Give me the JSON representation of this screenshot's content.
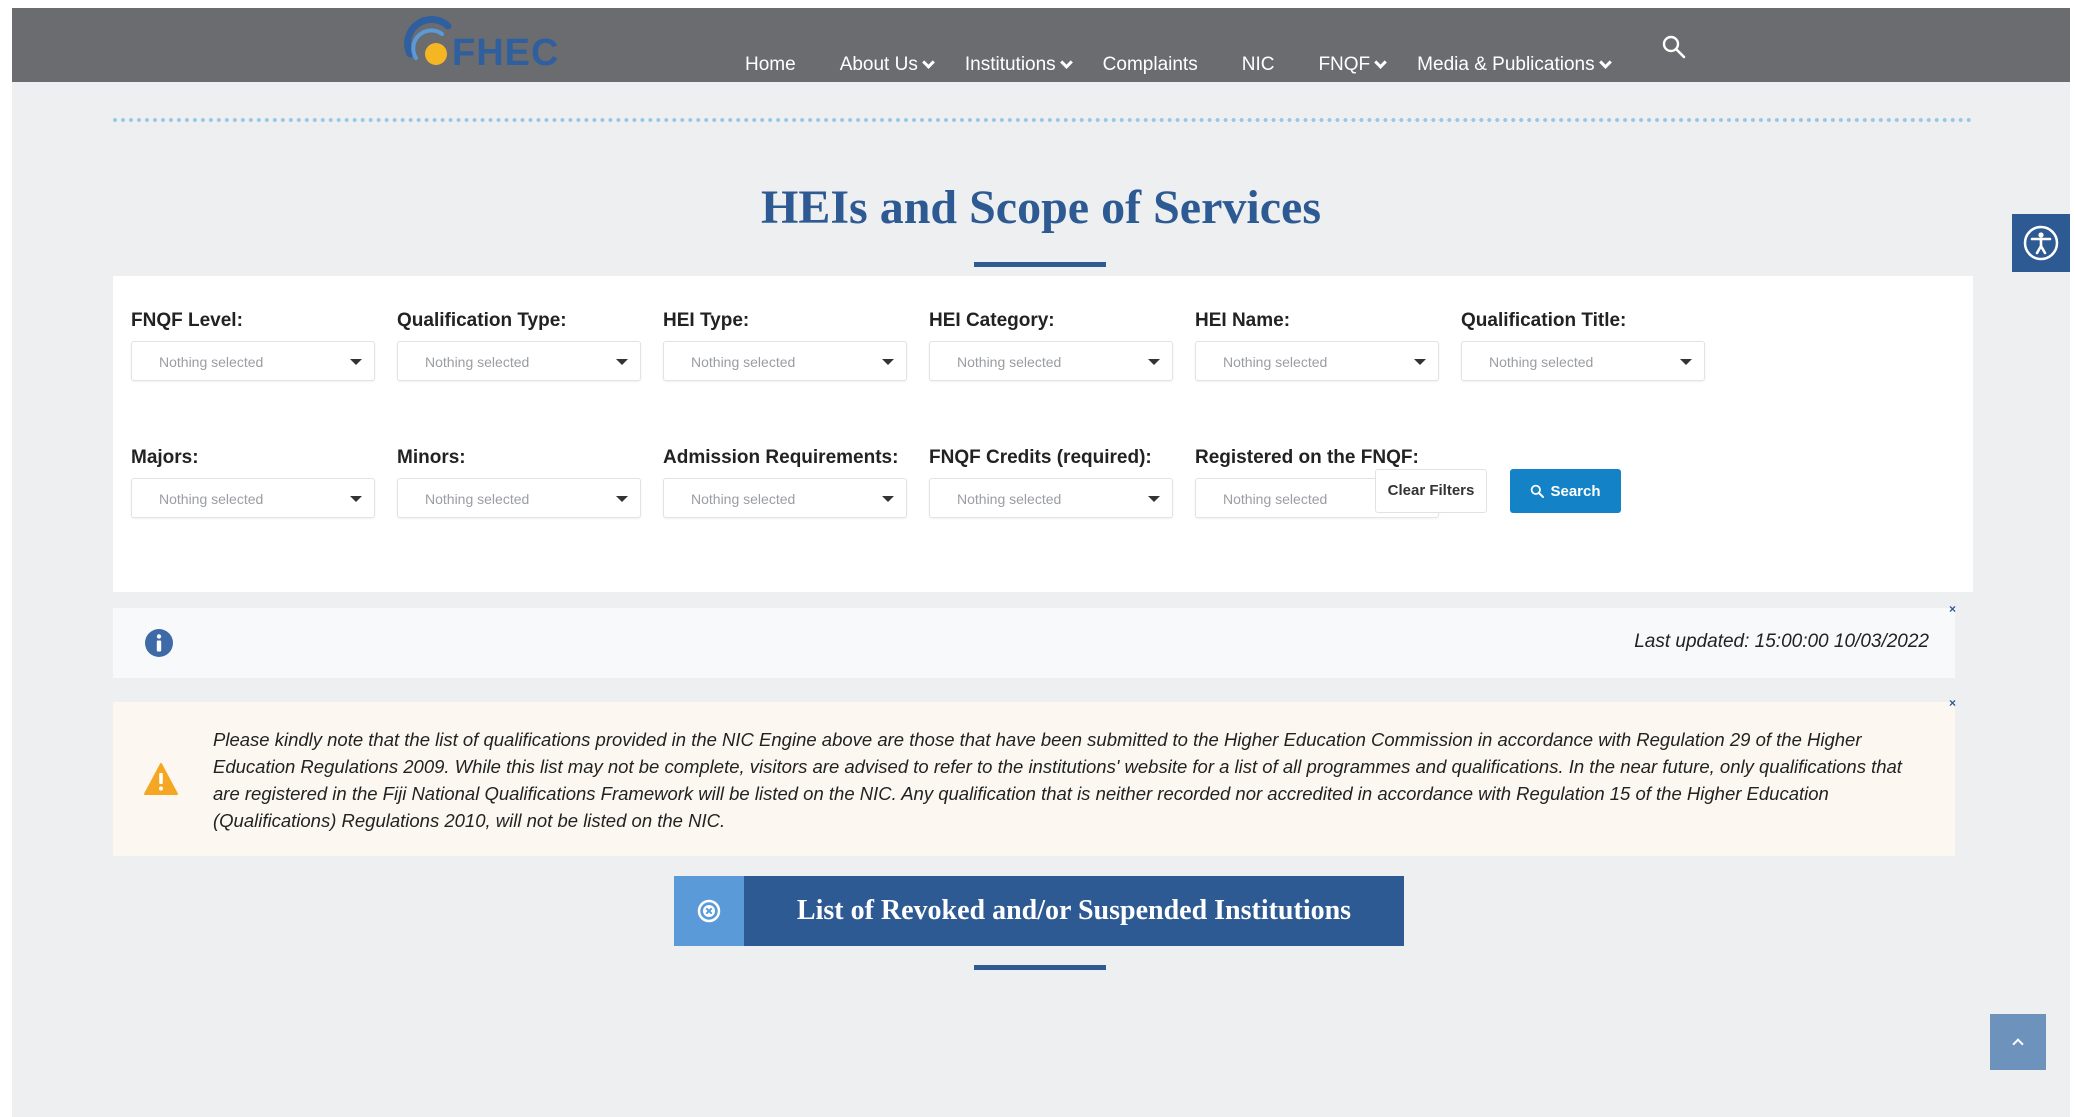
{
  "header": {
    "logo_text": "FHEC",
    "nav": [
      {
        "label": "Home",
        "dropdown": false
      },
      {
        "label": "About Us",
        "dropdown": true
      },
      {
        "label": "Institutions",
        "dropdown": true
      },
      {
        "label": "Complaints",
        "dropdown": false
      },
      {
        "label": "NIC",
        "dropdown": false
      },
      {
        "label": "FNQF",
        "dropdown": true
      },
      {
        "label": "Media & Publications",
        "dropdown": true
      }
    ],
    "search_icon": "search-icon"
  },
  "page_title": "HEIs and Scope of Services",
  "filters": {
    "fnqf_level": {
      "label": "FNQF Level:",
      "value": "Nothing selected"
    },
    "qualification_type": {
      "label": "Qualification Type:",
      "value": "Nothing selected"
    },
    "hei_type": {
      "label": "HEI Type:",
      "value": "Nothing selected"
    },
    "hei_category": {
      "label": "HEI Category:",
      "value": "Nothing selected"
    },
    "hei_name": {
      "label": "HEI Name:",
      "value": "Nothing selected"
    },
    "qualification_title": {
      "label": "Qualification Title:",
      "value": "Nothing selected"
    },
    "majors": {
      "label": "Majors:",
      "value": "Nothing selected"
    },
    "minors": {
      "label": "Minors:",
      "value": "Nothing selected"
    },
    "admission_requirements": {
      "label": "Admission Requirements:",
      "value": "Nothing selected"
    },
    "fnqf_credits": {
      "label": "FNQF Credits (required):",
      "value": "Nothing selected"
    },
    "registered_fnqf": {
      "label": "Registered on the FNQF:",
      "value": "Nothing selected"
    },
    "clear_label": "Clear Filters",
    "search_label": "Search"
  },
  "info": {
    "last_updated": "Last updated: 15:00:00 10/03/2022",
    "close": "×"
  },
  "notice": {
    "text": "Please kindly note that the list of qualifications provided in the NIC Engine above are those that have been submitted to the Higher Education Commission in accordance with Regulation 29 of the Higher Education Regulations 2009. While this list may not be complete, visitors are advised to refer to the institutions' website for a list of all programmes and qualifications. In the near future, only qualifications that are registered in the Fiji National Qualifications Framework will be listed on the NIC. Any qualification that is neither recorded nor accredited in accordance with Regulation 15 of the Higher Education (Qualifications) Regulations 2010, will not be listed on the NIC.",
    "close": "×"
  },
  "revoked_button_label": "List of Revoked and/or Suspended Institutions",
  "colors": {
    "navbar": "#6a6c70",
    "brand_blue": "#2e5a94",
    "search_button": "#1482c6",
    "warning_icon": "#f5a623"
  }
}
